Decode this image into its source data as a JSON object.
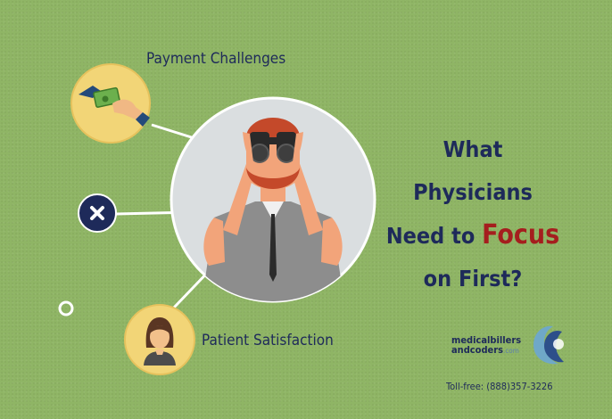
{
  "topics": {
    "payment_label": "Payment Challenges",
    "patient_label": "Patient Satisfaction"
  },
  "headline": {
    "line1": "What Physicians",
    "line2_prefix": "Need to",
    "line2_accent": "Focus",
    "line3": "on First?"
  },
  "brand": {
    "line1": "medicalbillers",
    "line2": "andcoders",
    "tld": ".com",
    "phone": "Toll-free: (888)357-3226"
  },
  "colors": {
    "background": "#8fb565",
    "navy": "#1e2a5a",
    "accent_red": "#a51e1e",
    "circle_yellow": "#f2d577",
    "circle_gray": "#dadee0",
    "connector": "#ffffff"
  }
}
